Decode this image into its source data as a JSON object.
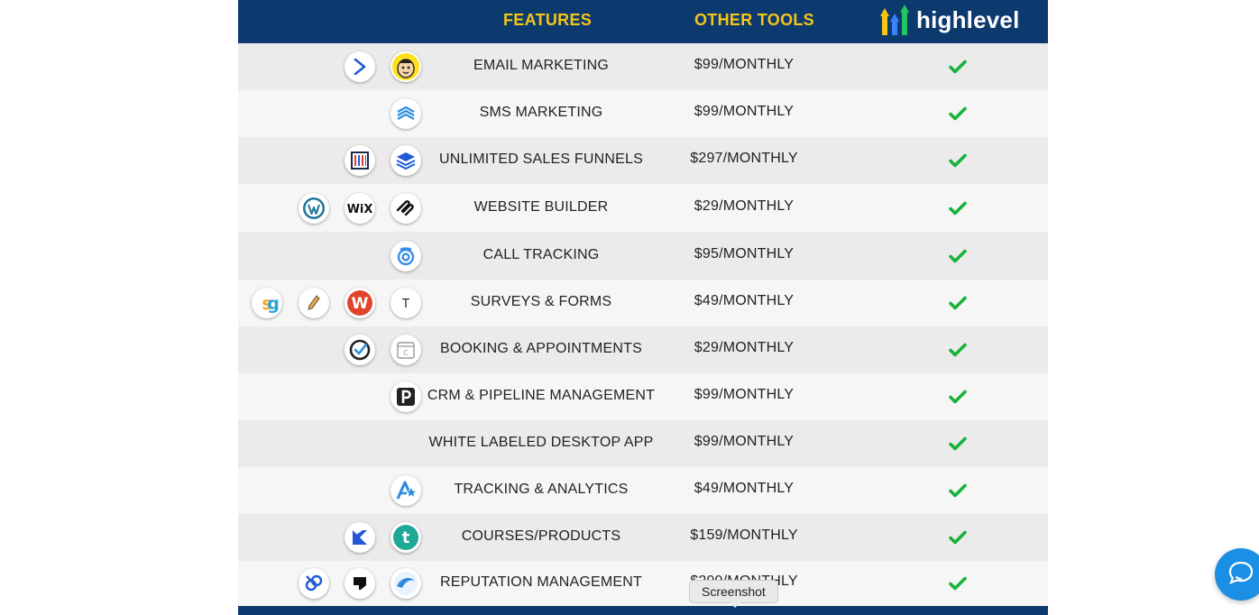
{
  "header": {
    "features_label": "FEATURES",
    "other_tools_label": "OTHER TOOLS",
    "brand_name": "highlevel"
  },
  "rows": [
    {
      "feature": "EMAIL MARKETING",
      "price": "$99/MONTHLY",
      "logos": [
        "activecampaign-icon",
        "mailchimp-icon"
      ]
    },
    {
      "feature": "SMS MARKETING",
      "price": "$99/MONTHLY",
      "logos": [
        "sms-stack-icon"
      ]
    },
    {
      "feature": "UNLIMITED SALES FUNNELS",
      "price": "$297/MONTHLY",
      "logos": [
        "clickfunnels-icon",
        "layers-icon"
      ]
    },
    {
      "feature": "WEBSITE BUILDER",
      "price": "$29/MONTHLY",
      "logos": [
        "wordpress-icon",
        "wix-icon",
        "squarespace-icon"
      ]
    },
    {
      "feature": "CALL TRACKING",
      "price": "$95/MONTHLY",
      "logos": [
        "callrail-icon"
      ]
    },
    {
      "feature": "SURVEYS & FORMS",
      "price": "$49/MONTHLY",
      "logos": [
        "surveygizmo-icon",
        "pen-icon",
        "wufoo-icon",
        "typeform-icon"
      ]
    },
    {
      "feature": "BOOKING & APPOINTMENTS",
      "price": "$29/MONTHLY",
      "logos": [
        "acuity-icon",
        "calendar-icon"
      ]
    },
    {
      "feature": "CRM & PIPELINE MANAGEMENT",
      "price": "$99/MONTHLY",
      "logos": [
        "pipedrive-icon"
      ]
    },
    {
      "feature": "WHITE LABELED DESKTOP APP",
      "price": "$99/MONTHLY",
      "logos": []
    },
    {
      "feature": "TRACKING & ANALYTICS",
      "price": "$49/MONTHLY",
      "logos": [
        "analytics-icon"
      ]
    },
    {
      "feature": "COURSES/PRODUCTS",
      "price": "$159/MONTHLY",
      "logos": [
        "kajabi-icon",
        "teachable-icon"
      ]
    },
    {
      "feature": "REPUTATION MANAGEMENT",
      "price": "$299/MONTHLY",
      "logos": [
        "birdeye-icon",
        "podium-icon",
        "swirl-icon"
      ]
    }
  ],
  "tooltip": {
    "text": "Screenshot"
  },
  "colors": {
    "header_bg": "#0d3a6e",
    "header_text": "#f5c518",
    "check": "#18b23a",
    "row_odd": "#ebebeb",
    "row_even": "#f6f6f6",
    "chat": "#1a8fe3"
  },
  "icons": {
    "check": "check-icon",
    "chat": "chat-icon"
  }
}
